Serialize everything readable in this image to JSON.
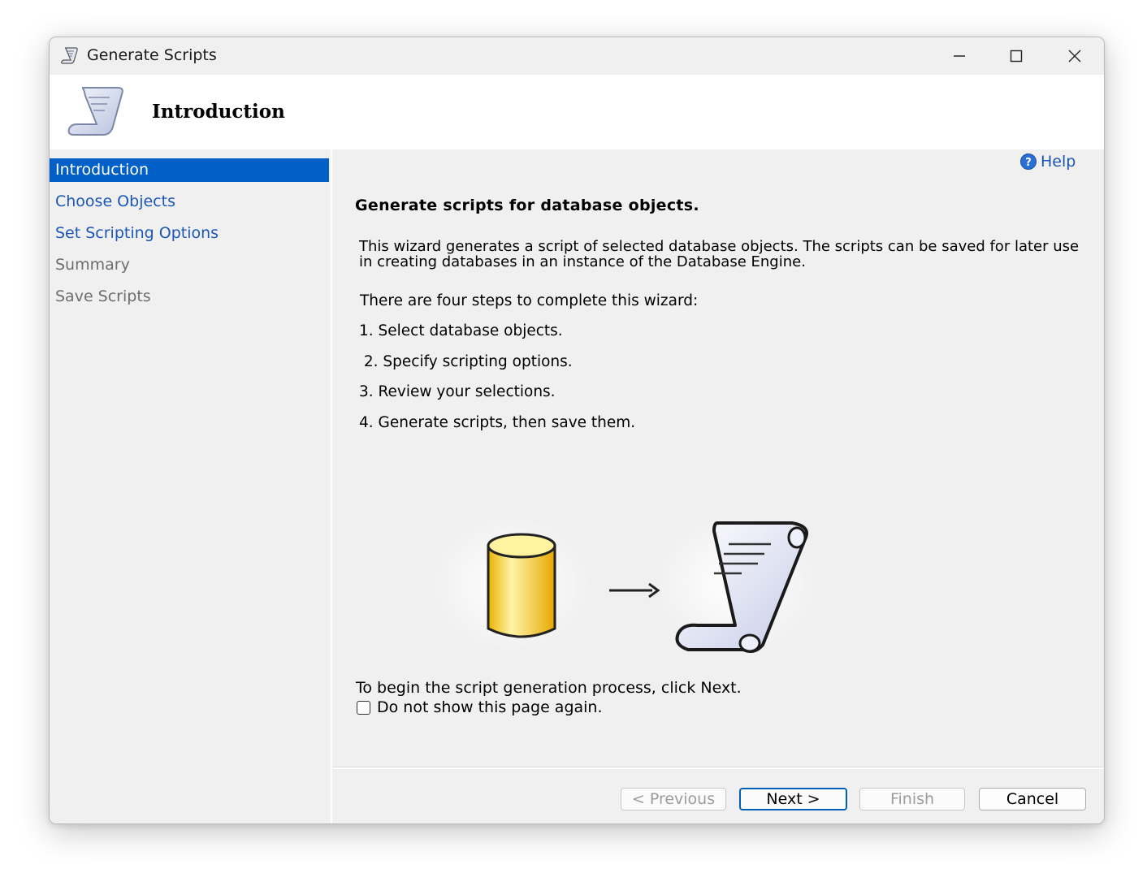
{
  "window": {
    "title": "Generate Scripts",
    "icon": "scroll-icon"
  },
  "banner": {
    "title": "Introduction",
    "icon": "scroll-icon"
  },
  "nav": {
    "items": [
      {
        "label": "Introduction",
        "state": "active"
      },
      {
        "label": "Choose Objects",
        "state": "link"
      },
      {
        "label": "Set Scripting Options",
        "state": "link"
      },
      {
        "label": "Summary",
        "state": "disabled"
      },
      {
        "label": "Save Scripts",
        "state": "disabled"
      }
    ]
  },
  "content": {
    "help_label": "Help",
    "heading": "Generate scripts for database objects.",
    "description": "This wizard generates a script of selected database objects. The scripts can be saved for later use in creating databases in an instance of the Database Engine.",
    "steps_intro": "There are four steps to complete this wizard:",
    "steps": [
      "1. Select database objects.",
      " 2. Specify scripting options.",
      "3. Review your selections.",
      "4. Generate scripts, then save them."
    ],
    "begin_text": "To begin the script generation process, click Next.",
    "checkbox_label": "Do not show this page again.",
    "checkbox_checked": false
  },
  "buttons": {
    "previous": "< Previous",
    "next": "Next >",
    "finish": "Finish",
    "cancel": "Cancel"
  },
  "colors": {
    "accent": "#0060c8",
    "link": "#1a57b8"
  }
}
